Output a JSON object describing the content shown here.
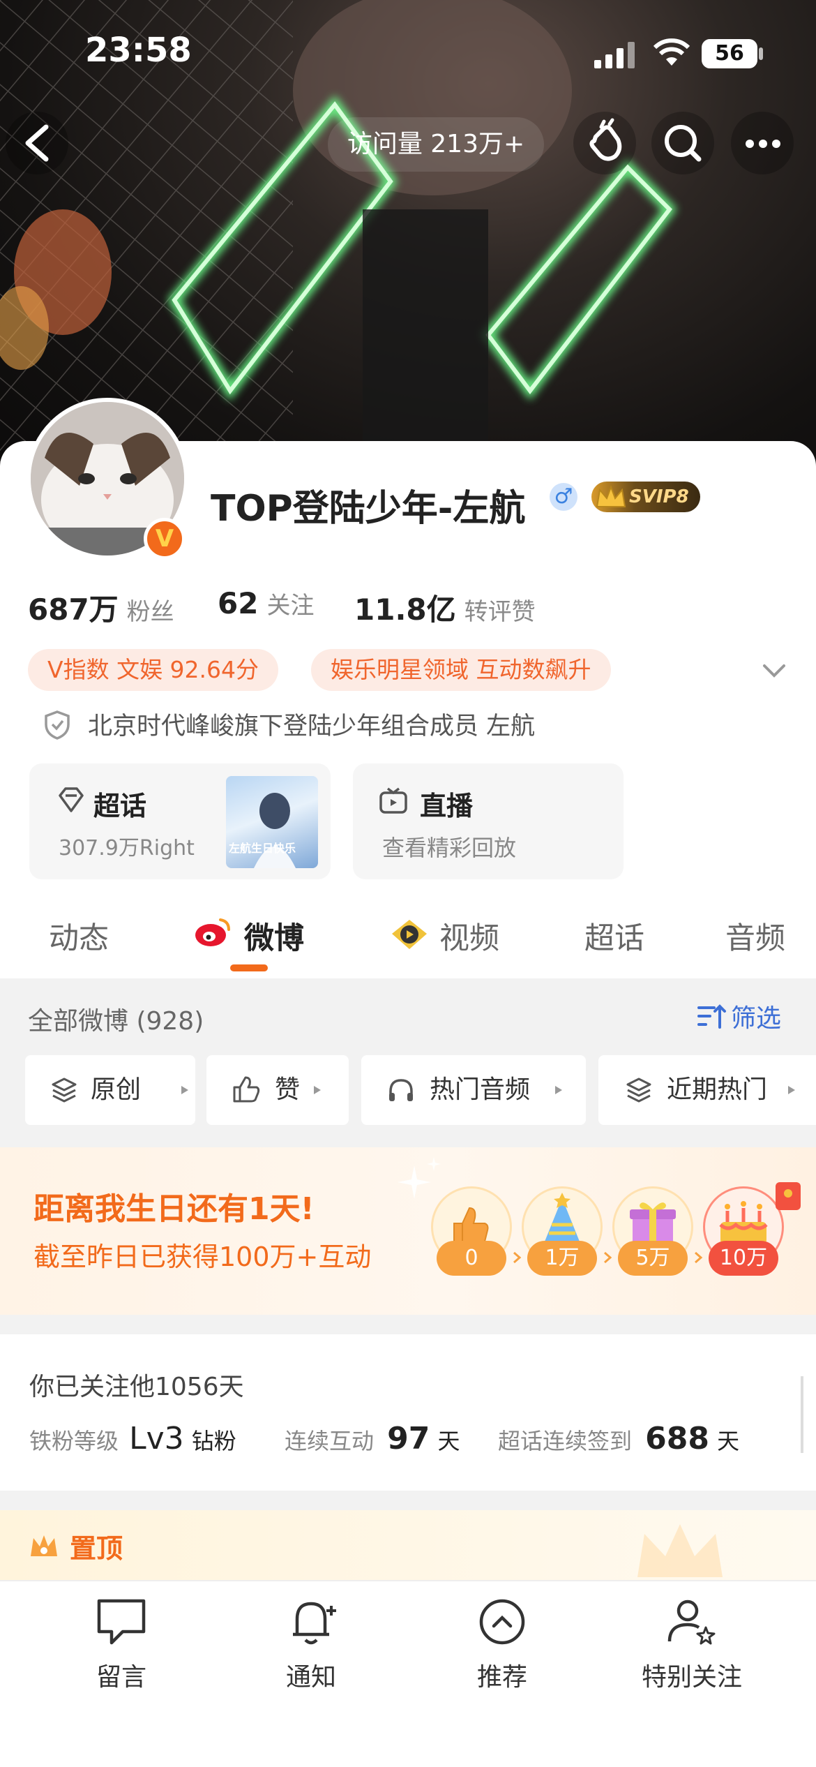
{
  "status_bar": {
    "time": "23:58",
    "battery": "56"
  },
  "header": {
    "visits_label": "访问量 213万+",
    "icons": [
      "back-icon",
      "tap-hand-icon",
      "search-icon",
      "more-icon"
    ]
  },
  "profile": {
    "name": "TOP登陆少年-左航",
    "gender_symbol": "♂",
    "svip_badge": "SVIP8",
    "verified_badge": "V",
    "stats": [
      {
        "value": "687万",
        "label": "粉丝"
      },
      {
        "value": "62",
        "label": "关注"
      },
      {
        "value": "11.8亿",
        "label": "转评赞"
      }
    ],
    "tags": [
      "V指数 文娱 92.64分",
      "娱乐明星领域 互动数飙升"
    ],
    "verification": "北京时代峰峻旗下登陆少年组合成员 左航"
  },
  "features": [
    {
      "title": "超话",
      "sub": "307.9万Right",
      "icon": "supertopic-icon",
      "thumb_text": "左航生日快乐"
    },
    {
      "title": "直播",
      "sub": "查看精彩回放",
      "icon": "tv-icon"
    }
  ],
  "tabs": [
    "动态",
    "微博",
    "视频",
    "超话",
    "音频"
  ],
  "feed": {
    "all_label": "全部微博 (928)",
    "filter_label": "筛选",
    "chips": [
      "原创",
      "赞",
      "热门音频",
      "近期热门"
    ]
  },
  "birthday": {
    "title": "距离我生日还有1天!",
    "subtitle": "截至昨日已获得100万+互动",
    "steps": [
      "0",
      "1万",
      "5万",
      "10万"
    ]
  },
  "follow_info": {
    "line1": "你已关注他1056天",
    "fan_level_label": "铁粉等级",
    "fan_level": "Lv3",
    "fan_level_suffix": "钻粉",
    "interact_label": "连续互动",
    "interact_days": "97",
    "day_unit": "天",
    "signin_label": "超话连续签到",
    "signin_days": "688"
  },
  "pinned_label": "置顶",
  "bottom_nav": [
    "留言",
    "通知",
    "推荐",
    "特别关注"
  ],
  "colors": {
    "accent": "#f26a1b",
    "weibo_red": "#e6162d",
    "filter_blue": "#3d6fd6",
    "tag_bg": "#fdebe4"
  }
}
